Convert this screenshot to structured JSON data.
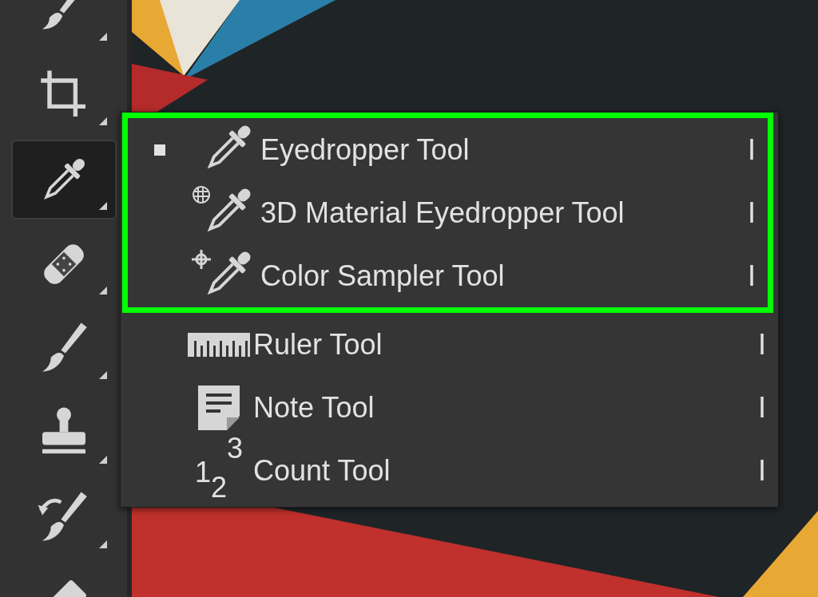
{
  "toolbar": {
    "tools": [
      {
        "selected": false
      },
      {
        "selected": false
      },
      {
        "selected": true
      },
      {
        "selected": false
      },
      {
        "selected": false
      },
      {
        "selected": false
      },
      {
        "selected": false
      },
      {
        "selected": false
      }
    ]
  },
  "menu": {
    "items": [
      {
        "label": "Eyedropper Tool",
        "shortcut": "I",
        "selected": true,
        "highlighted": true
      },
      {
        "label": "3D Material Eyedropper Tool",
        "shortcut": "I",
        "selected": false,
        "highlighted": true
      },
      {
        "label": "Color Sampler Tool",
        "shortcut": "I",
        "selected": false,
        "highlighted": true
      },
      {
        "label": "Ruler Tool",
        "shortcut": "I",
        "selected": false,
        "highlighted": false
      },
      {
        "label": "Note Tool",
        "shortcut": "I",
        "selected": false,
        "highlighted": false
      },
      {
        "label": "Count Tool",
        "shortcut": "I",
        "selected": false,
        "highlighted": false,
        "icon_text": "1$_{2}$$^{3}$"
      }
    ]
  }
}
